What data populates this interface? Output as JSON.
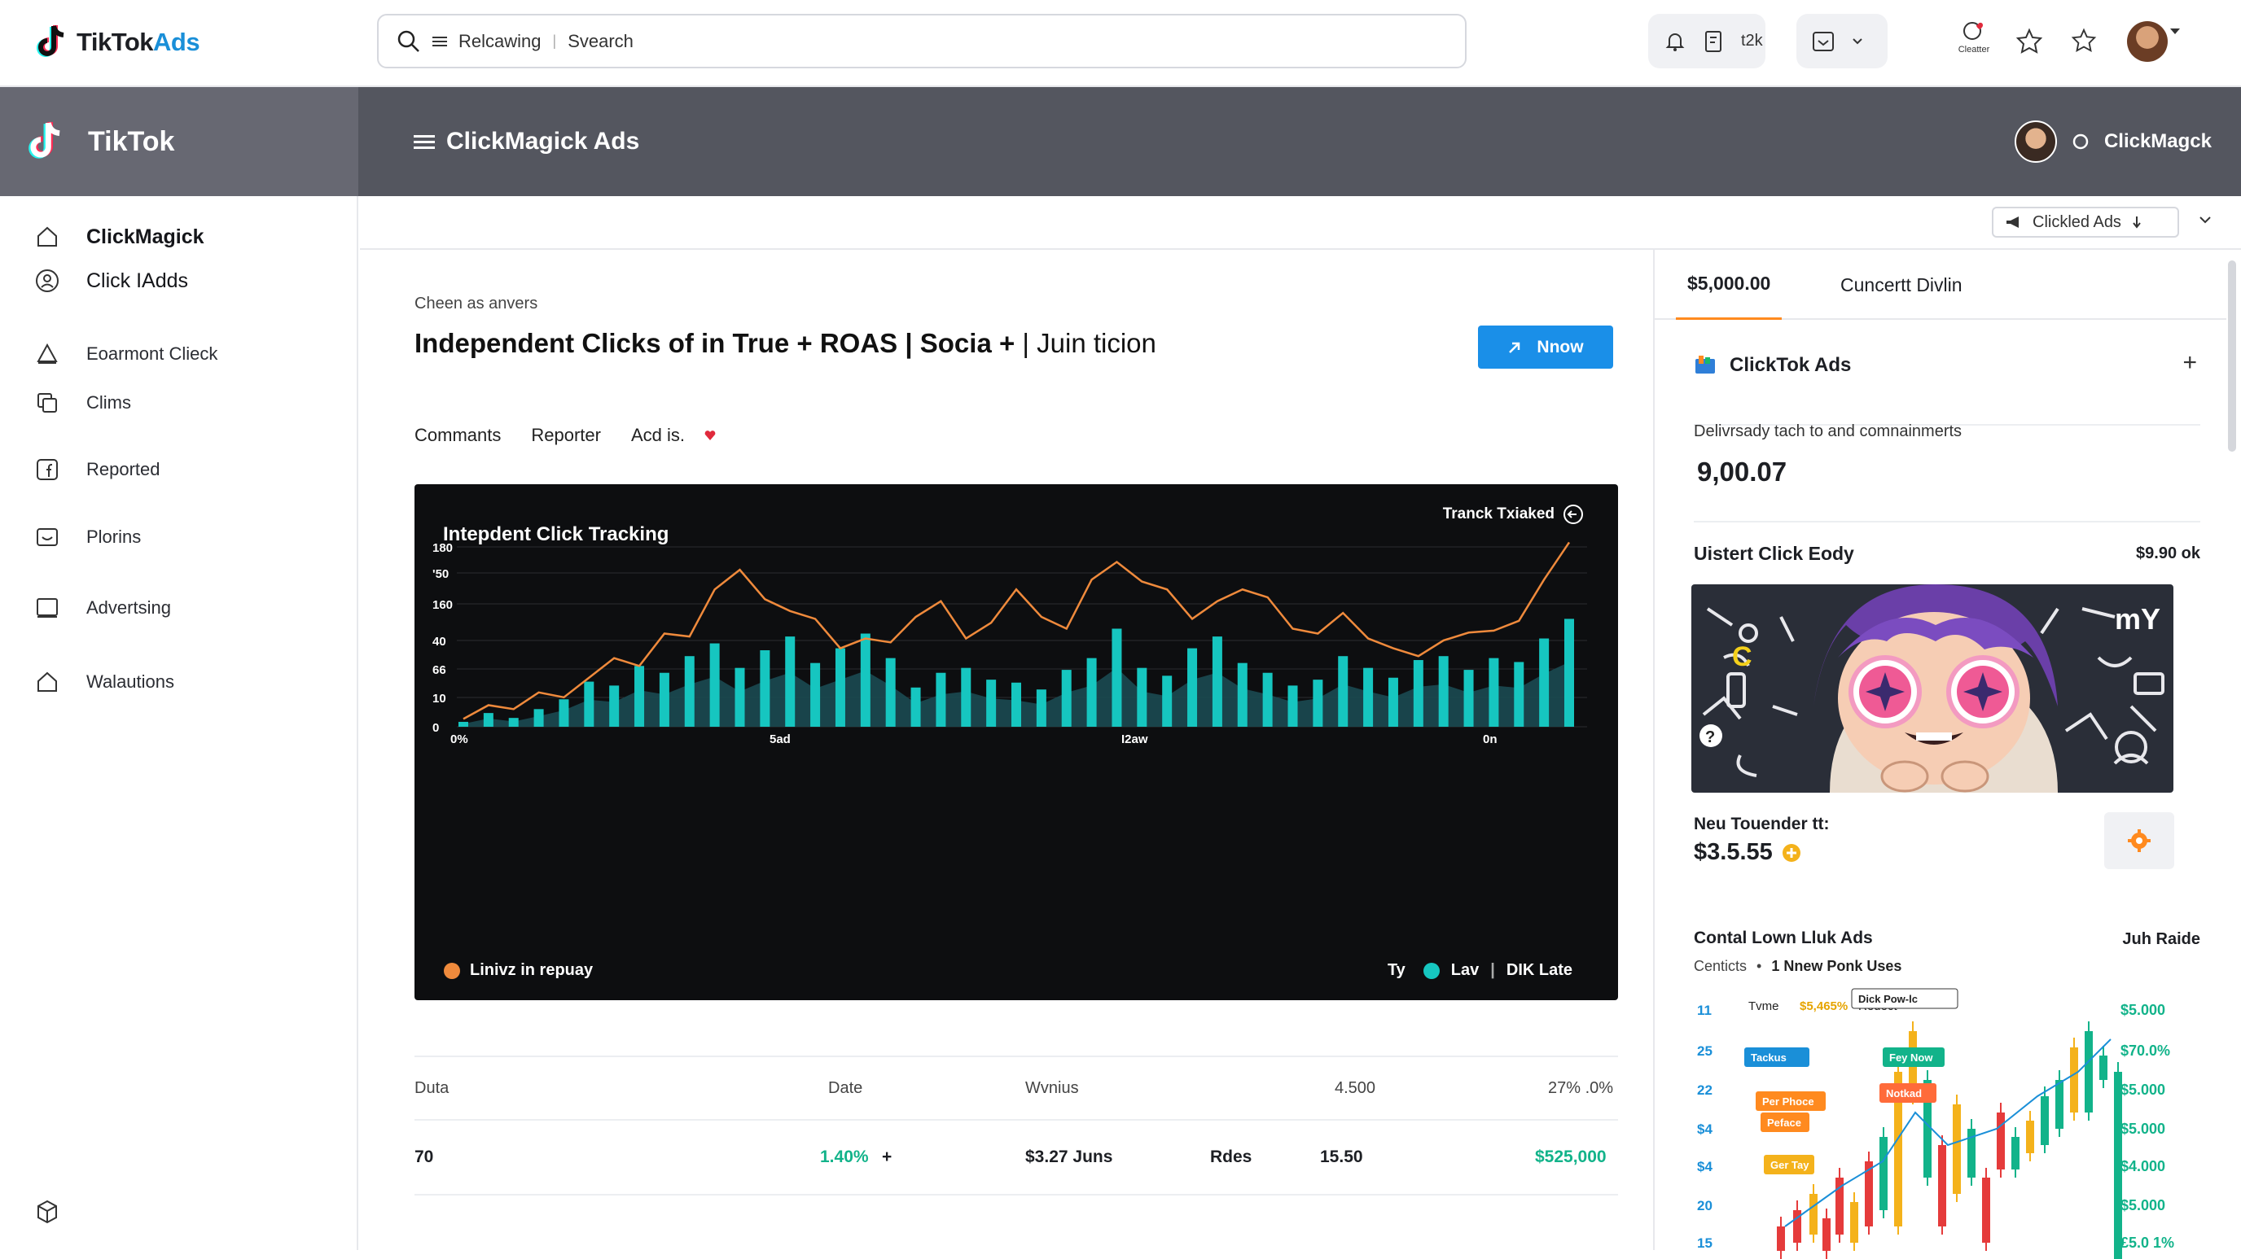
{
  "topbar": {
    "logo_text": "TikTok",
    "logo_suffix": "Ads",
    "search_value": "Relcawing",
    "search_placeholder": "Svearch",
    "group1_text": "t2k",
    "user_label": "Cleatter"
  },
  "header": {
    "brand": "TikTok",
    "title": "ClickMagick Ads",
    "account": "ClickMagck"
  },
  "sidebar": {
    "items": [
      {
        "label": "ClickMagick"
      },
      {
        "label": "Click IAdds"
      },
      {
        "label": "Eoarmont Clieck"
      },
      {
        "label": "Clims"
      },
      {
        "label": "Reported"
      },
      {
        "label": "Plorins"
      },
      {
        "label": "Advertsing"
      },
      {
        "label": "Walautions"
      }
    ]
  },
  "subbar": {
    "dropdown": "Clickled Ads"
  },
  "main": {
    "kicker": "Cheen as anvers",
    "title_bold": "Independent Clicks of in True + ROAS | Socia +",
    "title_thin": "| Juin ticion",
    "now_button": "Nnow",
    "tabs": [
      "Commants",
      "Reporter",
      "Acd is."
    ]
  },
  "chart": {
    "title": "Intepdent Click Tracking",
    "track_label": "Tranck Txiaked",
    "legend_left": "Linivz in repuay",
    "legend_right_1": "Ty",
    "legend_right_2": "Lav",
    "legend_right_3": "DIK Late",
    "colors": {
      "bars": "#16c6c0",
      "line": "#ef8a3c",
      "area": "#1b4a52"
    }
  },
  "chart_data": {
    "type": "bar",
    "title": "Intepdent Click Tracking",
    "y_ticks": [
      "180",
      "'50",
      "160",
      "40",
      "66",
      "10",
      "0"
    ],
    "x_ticks": [
      "0%",
      "5ad",
      "I2aw",
      "0n"
    ],
    "series": [
      {
        "name": "Lav",
        "values": [
          5,
          14,
          9,
          18,
          28,
          46,
          42,
          62,
          55,
          72,
          85,
          60,
          78,
          92,
          65,
          80,
          95,
          70,
          40,
          55,
          60,
          48,
          45,
          38,
          58,
          70,
          100,
          60,
          52,
          80,
          92,
          65,
          55,
          42,
          48,
          72,
          60,
          50,
          68,
          72,
          58,
          70,
          66,
          90,
          110
        ]
      },
      {
        "name": "Linivz in repuay",
        "values": [
          8,
          22,
          18,
          35,
          30,
          50,
          70,
          62,
          95,
          92,
          140,
          160,
          130,
          118,
          110,
          80,
          90,
          86,
          112,
          128,
          90,
          106,
          140,
          112,
          100,
          150,
          168,
          148,
          140,
          110,
          128,
          140,
          132,
          100,
          95,
          116,
          90,
          80,
          72,
          88,
          96,
          98,
          108,
          150,
          188
        ]
      }
    ]
  },
  "table": {
    "headers": [
      "Duta",
      "Date",
      "Wvnius",
      "4.500",
      "27% .0%"
    ],
    "row": {
      "c1": "70",
      "c2": "1.40%",
      "c2b": "+",
      "c3": "$3.27 Juns",
      "c4": "Rdes",
      "c5": "15.50",
      "c6": "$525,000"
    }
  },
  "right": {
    "tab_active": "$5,000.00",
    "tab_other": "Cuncertt Divlin",
    "card_title": "ClickTok Ads",
    "card_desc": "Delivrsady tach to and comnainmerts",
    "card_value": "9,00.07",
    "click_eody": "Uistert Click Eody",
    "click_eody_price": "$9.90 оk",
    "new_label": "Neu Touender tt:",
    "new_value": "$3.5.55",
    "contal_title": "Contal Lown Lluk Ads",
    "contal_right": "Juh Raide",
    "contal_sub_1": "Centicts",
    "contal_sub_2": "1 Nnew Ponk Uses",
    "mini_header": [
      "Tvme",
      "$5,465%",
      "Redect"
    ],
    "mini_tags": [
      "Dick Pow-lc",
      "Tackus",
      "Fey Now",
      "Per Phoce",
      "Notkad",
      "Peface",
      "Ger Tay"
    ],
    "mini_left_ticks": [
      "11",
      "25",
      "22",
      "$4",
      "$4",
      "20",
      "15"
    ],
    "mini_right_ticks": [
      "$5.000",
      "$70.0%",
      "$5.000",
      "$5.000",
      "$4.000",
      "$5.000",
      "£5.0 1%"
    ]
  }
}
